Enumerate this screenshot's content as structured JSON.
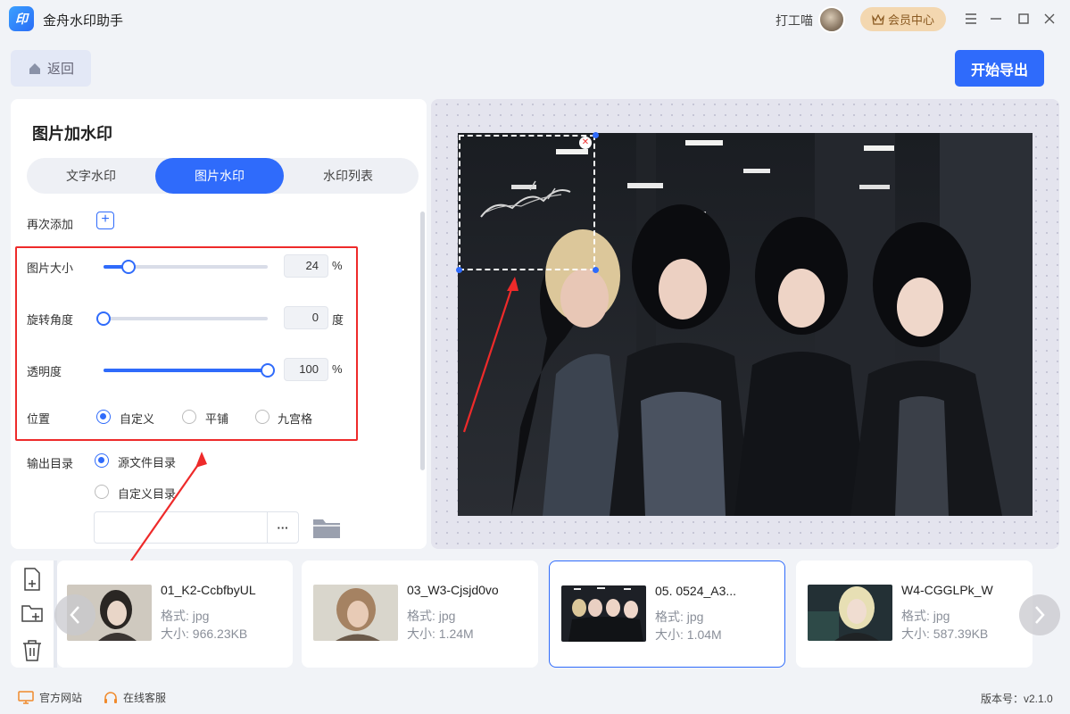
{
  "app": {
    "logo_text": "印",
    "title": "金舟水印助手"
  },
  "user": {
    "name": "打工喵",
    "vip_label": "会员中心"
  },
  "toolbar": {
    "back_label": "返回",
    "export_label": "开始导出"
  },
  "panel": {
    "title": "图片加水印",
    "tabs": [
      {
        "label": "文字水印",
        "active": false
      },
      {
        "label": "图片水印",
        "active": true
      },
      {
        "label": "水印列表",
        "active": false
      }
    ],
    "add_again_label": "再次添加",
    "size": {
      "label": "图片大小",
      "value": "24",
      "unit": "%",
      "fraction": 0.15
    },
    "rotation": {
      "label": "旋转角度",
      "value": "0",
      "unit": "度",
      "fraction": 0.0
    },
    "opacity": {
      "label": "透明度",
      "value": "100",
      "unit": "%",
      "fraction": 1.0
    },
    "position": {
      "label": "位置",
      "options": [
        "自定义",
        "平铺",
        "九宫格"
      ],
      "selected": "自定义"
    },
    "output": {
      "label": "输出目录",
      "options": [
        "源文件目录",
        "自定义目录"
      ],
      "selected": "源文件目录",
      "browse_label": "···"
    }
  },
  "files": [
    {
      "name": "01_K2-CcbfbyUL",
      "format": "格式: jpg",
      "size": "大小: 966.23KB",
      "selected": false
    },
    {
      "name": "03_W3-Cjsjd0vo",
      "format": "格式: jpg",
      "size": "大小: 1.24M",
      "selected": false
    },
    {
      "name": "05. 0524_A3...",
      "format": "格式: jpg",
      "size": "大小: 1.04M",
      "selected": true
    },
    {
      "name": "W4-CGGLPk_W",
      "format": "格式: jpg",
      "size": "大小: 587.39KB",
      "selected": false
    }
  ],
  "footer": {
    "website": "官方网站",
    "support": "在线客服",
    "version": "版本号：v2.1.0"
  },
  "colors": {
    "accent": "#2f6bfb",
    "highlight_box": "#ee2a2a",
    "vip": "#f3d7b0"
  }
}
